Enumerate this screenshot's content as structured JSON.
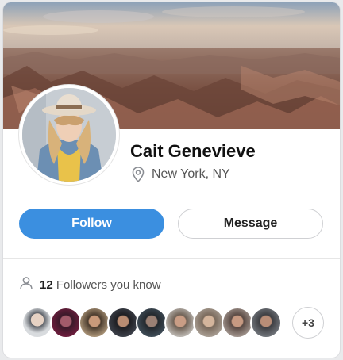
{
  "profile": {
    "name": "Cait Genevieve",
    "location": "New York, NY",
    "location_icon": "map-pin-icon",
    "follow_label": "Follow",
    "message_label": "Message"
  },
  "followers": {
    "count": "12",
    "text": "Followers you know",
    "icon": "user-icon",
    "more_label": "+3",
    "avatar_count": 9
  },
  "colors": {
    "accent": "#3b8fe0",
    "card": "#ffffff",
    "background": "#e9eaec"
  }
}
